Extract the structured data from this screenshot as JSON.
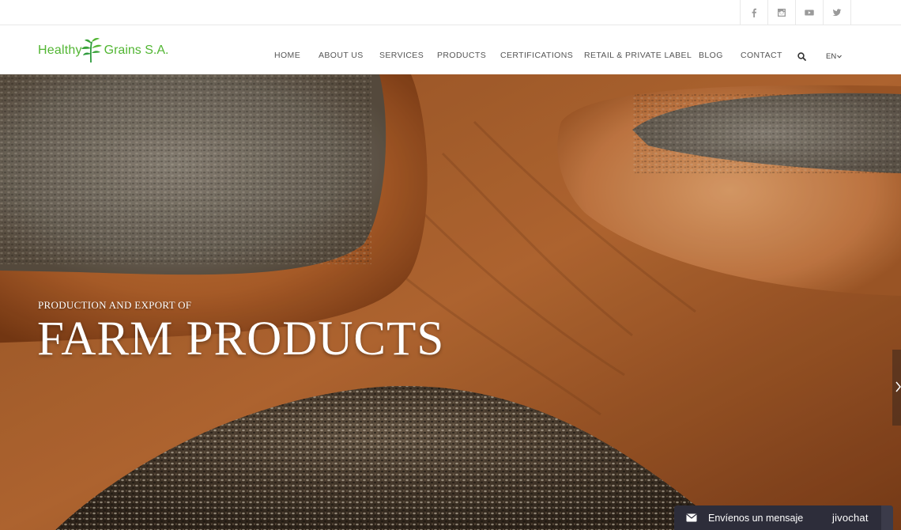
{
  "social": {
    "icons": [
      "facebook-icon",
      "instagram-icon",
      "youtube-icon",
      "twitter-icon"
    ]
  },
  "logo": {
    "word1": "Healthy",
    "word2": "Grains S.A.",
    "color": "#52b633"
  },
  "nav": {
    "items": [
      "HOME",
      "ABOUT US",
      "SERVICES",
      "PRODUCTS",
      "CERTIFICATIONS",
      "RETAIL & PRIVATE LABEL",
      "BLOG",
      "CONTACT"
    ],
    "language": "EN"
  },
  "hero": {
    "subtitle": "PRODUCTION AND EXPORT OF",
    "title": "FARM PRODUCTS"
  },
  "chat": {
    "message": "Envíenos un mensaje",
    "brand": "jivochat"
  }
}
